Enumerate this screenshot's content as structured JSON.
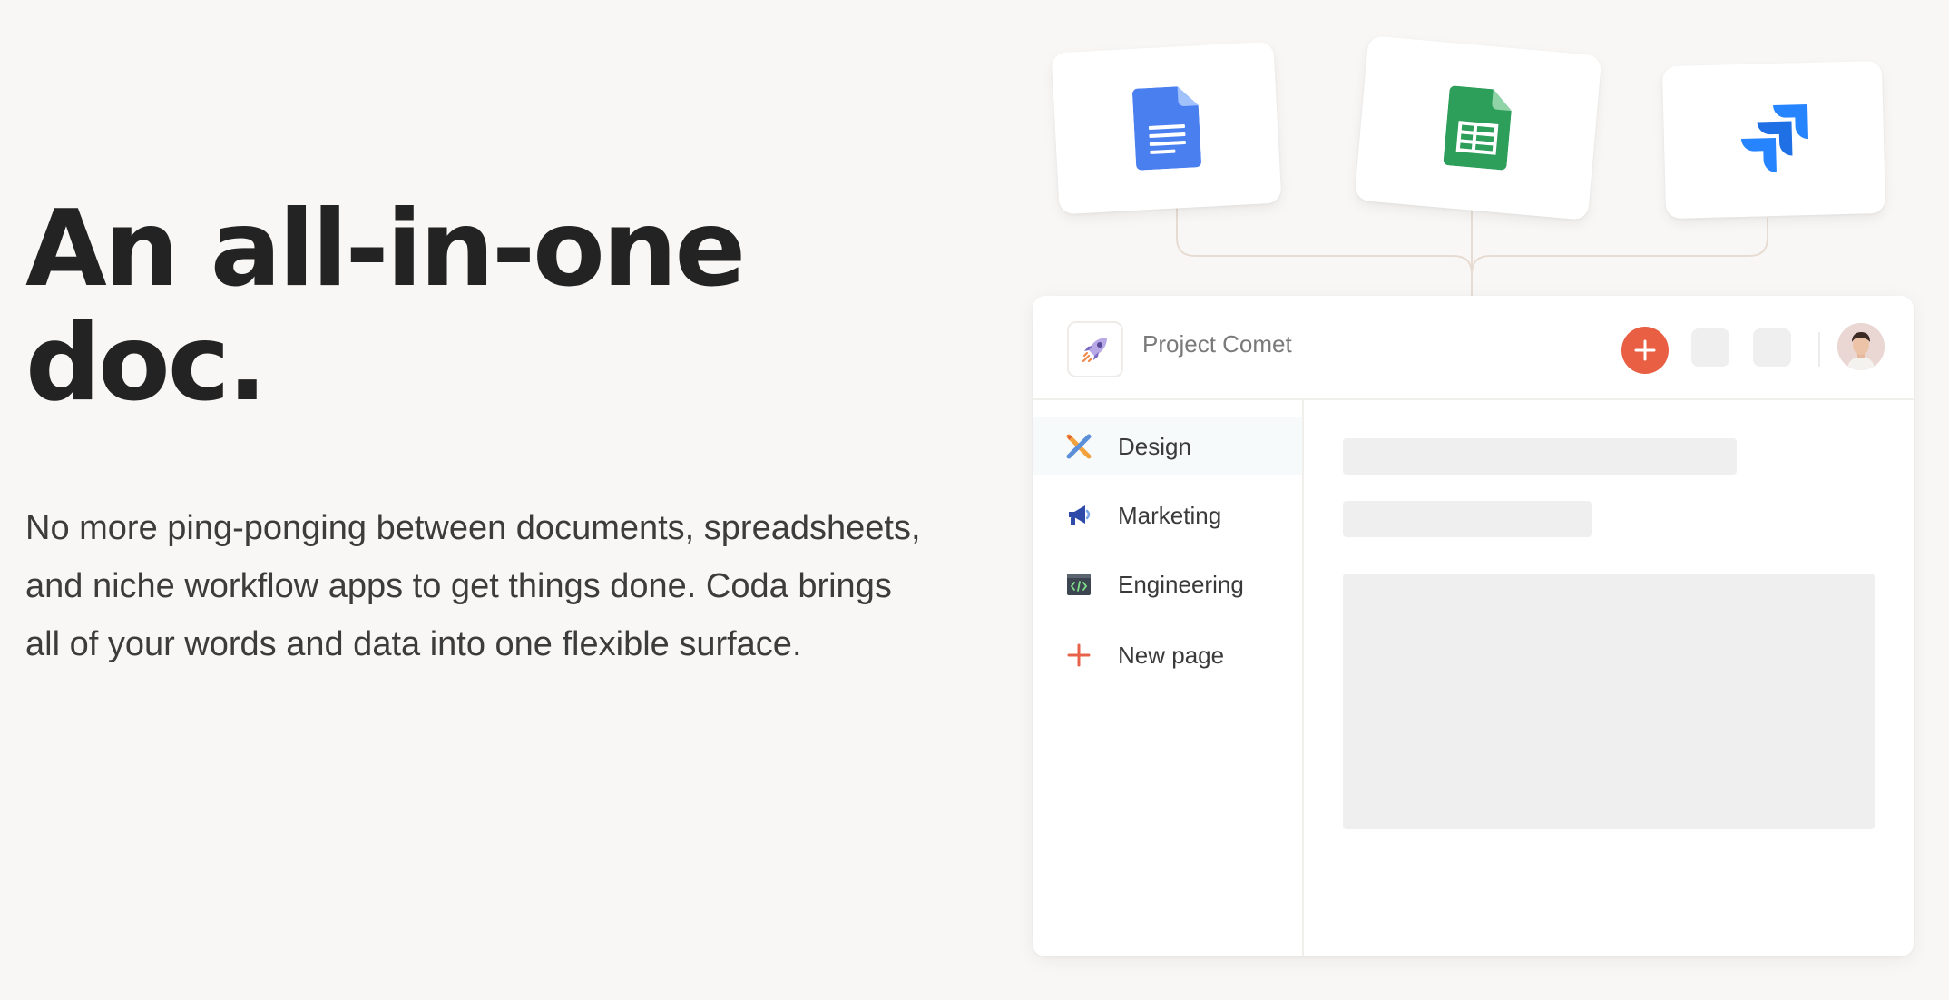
{
  "hero": {
    "headline": "An all-in-one doc.",
    "description": "No more ping-ponging between documents, spreadsheets, and niche workflow apps to get things done. Coda brings all of your words and data into one flexible surface."
  },
  "integrations": [
    {
      "icon": "google-docs-icon",
      "color": "#4285f4"
    },
    {
      "icon": "google-sheets-icon",
      "color": "#34a853"
    },
    {
      "icon": "jira-icon",
      "color": "#2684ff"
    }
  ],
  "app": {
    "doc_icon": "rocket-icon",
    "title": "Project Comet",
    "add_button_color": "#e85f44",
    "sidebar": {
      "items": [
        {
          "label": "Design",
          "icon": "design-tools-icon",
          "active": true
        },
        {
          "label": "Marketing",
          "icon": "megaphone-icon",
          "active": false
        },
        {
          "label": "Engineering",
          "icon": "code-window-icon",
          "active": false
        },
        {
          "label": "New page",
          "icon": "plus-icon",
          "active": false
        }
      ]
    }
  }
}
